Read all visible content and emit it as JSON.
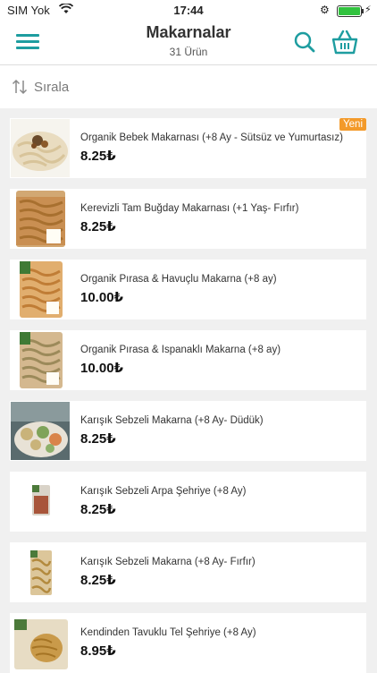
{
  "status_bar": {
    "carrier": "SIM Yok",
    "time": "17:44"
  },
  "header": {
    "title": "Makarnalar",
    "subtitle": "31 Ürün"
  },
  "sort": {
    "label": "Sırala"
  },
  "colors": {
    "accent": "#1e9da0",
    "badge": "#f39a2a"
  },
  "products": [
    {
      "name": "Organik Bebek Makarnası (+8 Ay - Sütsüz ve Yumurtasız)",
      "price": "8.25₺",
      "badge": "Yeni"
    },
    {
      "name": "Kerevizli Tam Buğday Makarnası (+1 Yaş- Fırfır)",
      "price": "8.25₺"
    },
    {
      "name": "Organik Pırasa & Havuçlu Makarna (+8 ay)",
      "price": "10.00₺"
    },
    {
      "name": "Organik Pırasa & Ispanaklı Makarna (+8 ay)",
      "price": "10.00₺"
    },
    {
      "name": "Karışık Sebzeli Makarna (+8 Ay- Düdük)",
      "price": "8.25₺"
    },
    {
      "name": "Karışık Sebzeli Arpa Şehriye (+8 Ay)",
      "price": "8.25₺"
    },
    {
      "name": "Karışık Sebzeli Makarna (+8 Ay- Fırfır)",
      "price": "8.25₺"
    },
    {
      "name": "Kendinden Tavuklu Tel Şehriye (+8 Ay)",
      "price": "8.95₺"
    }
  ]
}
